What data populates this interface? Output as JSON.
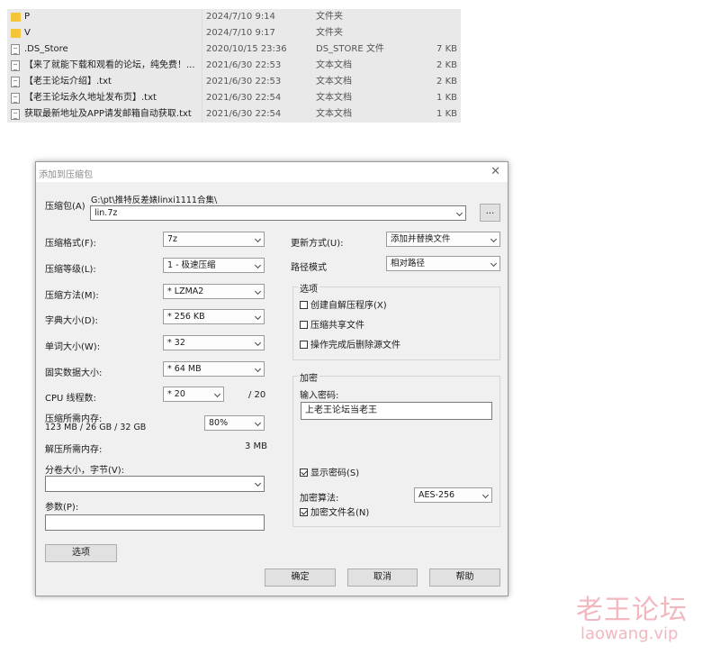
{
  "files": [
    {
      "name": "P",
      "date": "2024/7/10 9:14",
      "type": "文件夹",
      "size": "",
      "icon": "folder-icon"
    },
    {
      "name": "V",
      "date": "2024/7/10 9:17",
      "type": "文件夹",
      "size": "",
      "icon": "folder-icon"
    },
    {
      "name": ".DS_Store",
      "date": "2020/10/15 23:36",
      "type": "DS_STORE 文件",
      "size": "7 KB",
      "icon": "file-icon"
    },
    {
      "name": "【来了就能下载和观看的论坛，纯免费！...",
      "date": "2021/6/30 22:53",
      "type": "文本文档",
      "size": "2 KB",
      "icon": "text-file-icon"
    },
    {
      "name": "【老王论坛介绍】.txt",
      "date": "2021/6/30 22:53",
      "type": "文本文档",
      "size": "2 KB",
      "icon": "text-file-icon"
    },
    {
      "name": "【老王论坛永久地址发布页】.txt",
      "date": "2021/6/30 22:54",
      "type": "文本文档",
      "size": "1 KB",
      "icon": "text-file-icon"
    },
    {
      "name": "获取最新地址及APP请发邮箱自动获取.txt",
      "date": "2021/6/30 22:54",
      "type": "文本文档",
      "size": "1 KB",
      "icon": "text-file-icon"
    }
  ],
  "dialog": {
    "title": "添加到压缩包",
    "close_glyph": "✕",
    "archive_label": "压缩包(A)",
    "archive_path": "G:\\pt\\推特反差婊linxi1111合集\\",
    "archive_name": "lin.7z",
    "browse_label": "...",
    "format_label": "压缩格式(F):",
    "format_value": "7z",
    "level_label": "压缩等级(L):",
    "level_value": "1 - 极速压缩",
    "method_label": "压缩方法(M):",
    "method_value": "* LZMA2",
    "dict_label": "字典大小(D):",
    "dict_value": "* 256 KB",
    "word_label": "单词大小(W):",
    "word_value": "* 32",
    "solid_label": "固实数据大小:",
    "solid_value": "* 64 MB",
    "cpu_label": "CPU 线程数:",
    "cpu_value": "* 20",
    "cpu_total": "/ 20",
    "mem_comp_label": "压缩所需内存:",
    "mem_comp_detail": "123 MB / 26 GB / 32 GB",
    "mem_comp_percent": "80%",
    "mem_decomp_label": "解压所需内存:",
    "mem_decomp_value": "3 MB",
    "split_label": "分卷大小，字节(V):",
    "split_value": "",
    "params_label": "参数(P):",
    "params_value": "",
    "options_button": "选项",
    "update_label": "更新方式(U):",
    "update_value": "添加并替换文件",
    "path_label": "路径模式",
    "path_value": "相对路径",
    "options_group": "选项",
    "opt_sfx": "创建自解压程序(X)",
    "opt_shared": "压缩共享文件",
    "opt_delete": "操作完成后删除源文件",
    "encrypt_group": "加密",
    "password_label": "输入密码:",
    "password_value": "上老王论坛当老王",
    "show_password": "显示密码(S)",
    "enc_method_label": "加密算法:",
    "enc_method_value": "AES-256",
    "encrypt_names": "加密文件名(N)",
    "ok_button": "确定",
    "cancel_button": "取消",
    "help_button": "帮助"
  },
  "watermark": {
    "line1": "老王论坛",
    "line2": "laowang.vip"
  }
}
